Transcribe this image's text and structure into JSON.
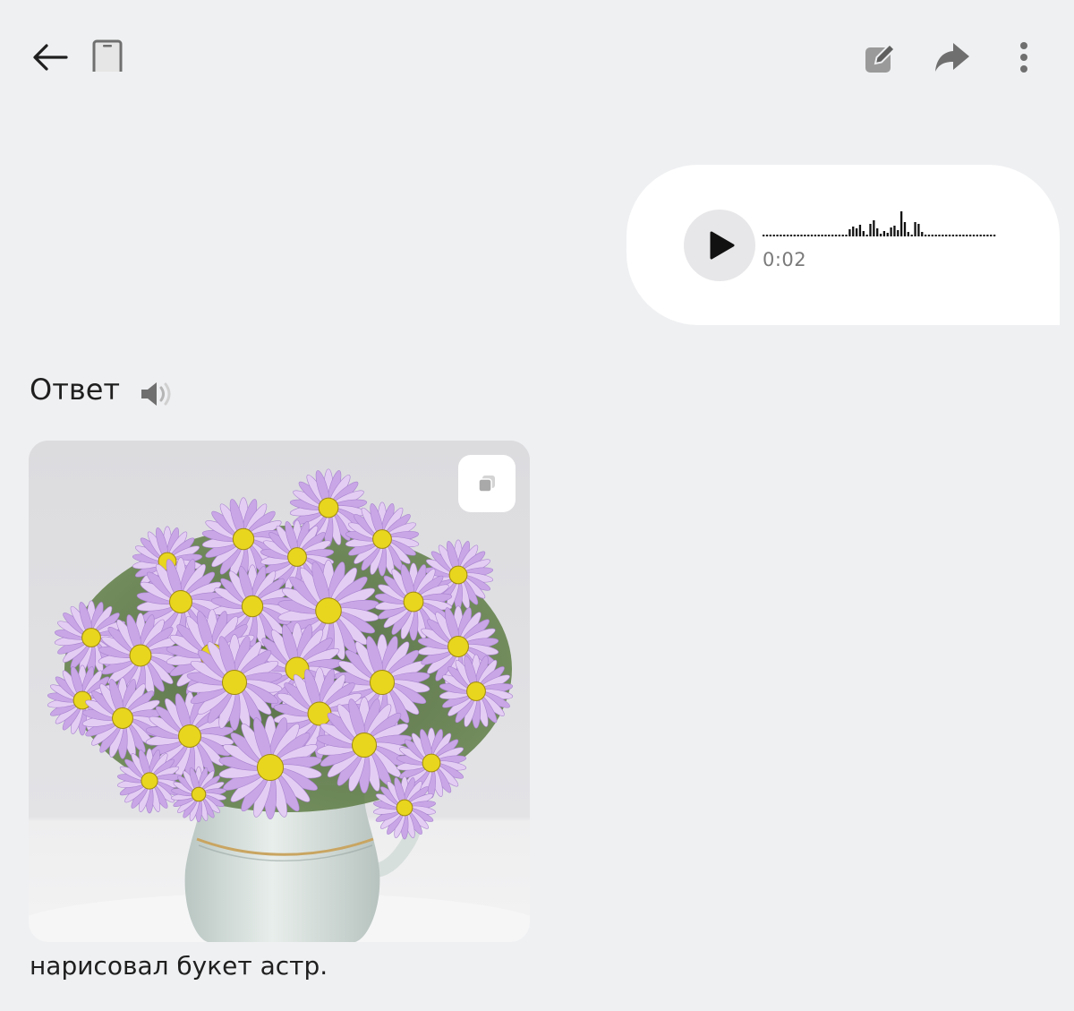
{
  "toolbar": {
    "back_icon": "arrow-left-icon",
    "device_icon": "phone-icon",
    "edit_icon": "pencil-icon",
    "share_icon": "share-arrow-icon",
    "more_icon": "more-vertical-icon"
  },
  "voice_message": {
    "duration": "0:02",
    "play_icon": "play-icon"
  },
  "answer": {
    "label": "Ответ",
    "speaker_icon": "speaker-icon",
    "image_alt": "Букет астр в вазе",
    "copy_icon": "copy-icon",
    "caption": "нарисовал букет астр."
  },
  "colors": {
    "background": "#eff0f2",
    "bubble": "#ffffff",
    "text": "#1f1f1f",
    "muted": "#7a7a7a",
    "icon": "#6f6f6f",
    "flower_petal": "#c9a6e6",
    "flower_center": "#e8d51e"
  }
}
